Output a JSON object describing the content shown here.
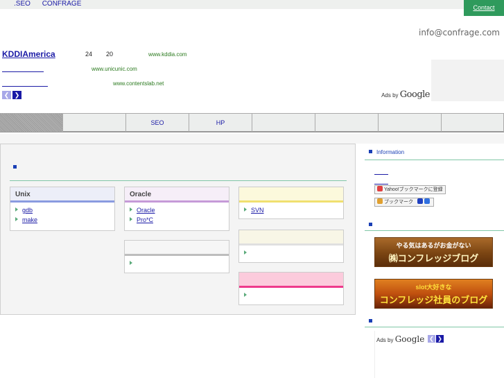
{
  "header": {
    "links": [
      ".SEO",
      "CONFRAGE"
    ],
    "contact_label": "Contact",
    "email": "info@confrage.com"
  },
  "ads": {
    "items": [
      {
        "title": "KDDIAmerica",
        "text1": "24",
        "text2": "20",
        "url": "www.kddia.com"
      },
      {
        "title": "",
        "url": "www.unicunic.com"
      },
      {
        "title": "",
        "url": "www.contentslab.net"
      }
    ],
    "prev_icon": "chevron-left-icon",
    "next_icon": "chevron-right-icon",
    "ads_by": "Ads by",
    "google": "Google"
  },
  "nav": {
    "items": [
      "",
      "",
      "SEO",
      "HP",
      "",
      "",
      "",
      ""
    ]
  },
  "main": {
    "cards": [
      {
        "title": "Unix",
        "accent": "#8a9be0",
        "links": [
          "gdb",
          "make"
        ]
      },
      {
        "title": "Oracle",
        "accent": "#c59ad8",
        "links": [
          "Oracle",
          "Pro*C"
        ]
      },
      {
        "title": "",
        "accent": "#f0e070",
        "links": [
          "SVN"
        ]
      },
      {
        "title": "",
        "accent": "#bdbdbd",
        "links": [
          ""
        ]
      },
      {
        "title": "",
        "accent": "#e0e0e0",
        "links": [
          ""
        ]
      },
      {
        "title": "",
        "accent": "#ee3a8c",
        "links": [
          ""
        ]
      }
    ]
  },
  "sidebar": {
    "info_title": "Information",
    "yahoo_bookmark": "Yahoo!ブックマークに登録",
    "bookmark": "ブックマーク",
    "banner1_top": "やる気はあるがお金がない",
    "banner1_main": "㈱コンフレッジブログ",
    "banner2_top": "slot大好きな",
    "banner2_main": "コンフレッジ社員のブログ",
    "ads_by": "Ads by",
    "google": "Google"
  },
  "colors": {
    "accent_green": "#2f9a5c",
    "link_blue": "#1a1aa6",
    "nav_blue": "#3b5fd9"
  }
}
